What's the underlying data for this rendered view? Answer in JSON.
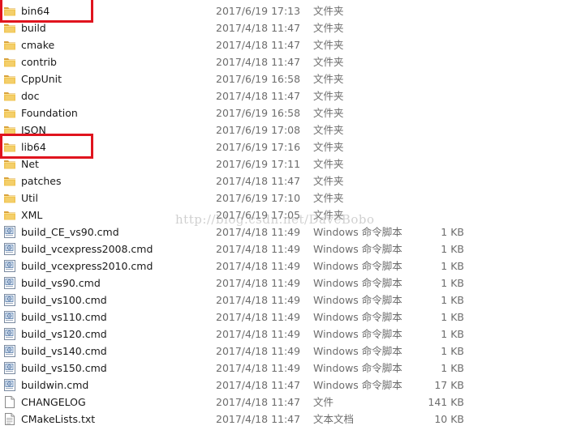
{
  "files": [
    {
      "name": "bin64",
      "date": "2017/6/19 17:13",
      "type": "文件夹",
      "size": "",
      "icon": "folder-icon"
    },
    {
      "name": "build",
      "date": "2017/4/18 11:47",
      "type": "文件夹",
      "size": "",
      "icon": "folder-icon"
    },
    {
      "name": "cmake",
      "date": "2017/4/18 11:47",
      "type": "文件夹",
      "size": "",
      "icon": "folder-icon"
    },
    {
      "name": "contrib",
      "date": "2017/4/18 11:47",
      "type": "文件夹",
      "size": "",
      "icon": "folder-icon"
    },
    {
      "name": "CppUnit",
      "date": "2017/6/19 16:58",
      "type": "文件夹",
      "size": "",
      "icon": "folder-icon"
    },
    {
      "name": "doc",
      "date": "2017/4/18 11:47",
      "type": "文件夹",
      "size": "",
      "icon": "folder-icon"
    },
    {
      "name": "Foundation",
      "date": "2017/6/19 16:58",
      "type": "文件夹",
      "size": "",
      "icon": "folder-icon"
    },
    {
      "name": "JSON",
      "date": "2017/6/19 17:08",
      "type": "文件夹",
      "size": "",
      "icon": "folder-icon"
    },
    {
      "name": "lib64",
      "date": "2017/6/19 17:16",
      "type": "文件夹",
      "size": "",
      "icon": "folder-icon"
    },
    {
      "name": "Net",
      "date": "2017/6/19 17:11",
      "type": "文件夹",
      "size": "",
      "icon": "folder-icon"
    },
    {
      "name": "patches",
      "date": "2017/4/18 11:47",
      "type": "文件夹",
      "size": "",
      "icon": "folder-icon"
    },
    {
      "name": "Util",
      "date": "2017/6/19 17:10",
      "type": "文件夹",
      "size": "",
      "icon": "folder-icon"
    },
    {
      "name": "XML",
      "date": "2017/6/19 17:05",
      "type": "文件夹",
      "size": "",
      "icon": "folder-icon"
    },
    {
      "name": "build_CE_vs90.cmd",
      "date": "2017/4/18 11:49",
      "type": "Windows 命令脚本",
      "size": "1 KB",
      "icon": "cmd-script-icon"
    },
    {
      "name": "build_vcexpress2008.cmd",
      "date": "2017/4/18 11:49",
      "type": "Windows 命令脚本",
      "size": "1 KB",
      "icon": "cmd-script-icon"
    },
    {
      "name": "build_vcexpress2010.cmd",
      "date": "2017/4/18 11:49",
      "type": "Windows 命令脚本",
      "size": "1 KB",
      "icon": "cmd-script-icon"
    },
    {
      "name": "build_vs90.cmd",
      "date": "2017/4/18 11:49",
      "type": "Windows 命令脚本",
      "size": "1 KB",
      "icon": "cmd-script-icon"
    },
    {
      "name": "build_vs100.cmd",
      "date": "2017/4/18 11:49",
      "type": "Windows 命令脚本",
      "size": "1 KB",
      "icon": "cmd-script-icon"
    },
    {
      "name": "build_vs110.cmd",
      "date": "2017/4/18 11:49",
      "type": "Windows 命令脚本",
      "size": "1 KB",
      "icon": "cmd-script-icon"
    },
    {
      "name": "build_vs120.cmd",
      "date": "2017/4/18 11:49",
      "type": "Windows 命令脚本",
      "size": "1 KB",
      "icon": "cmd-script-icon"
    },
    {
      "name": "build_vs140.cmd",
      "date": "2017/4/18 11:49",
      "type": "Windows 命令脚本",
      "size": "1 KB",
      "icon": "cmd-script-icon"
    },
    {
      "name": "build_vs150.cmd",
      "date": "2017/4/18 11:49",
      "type": "Windows 命令脚本",
      "size": "1 KB",
      "icon": "cmd-script-icon"
    },
    {
      "name": "buildwin.cmd",
      "date": "2017/4/18 11:47",
      "type": "Windows 命令脚本",
      "size": "17 KB",
      "icon": "cmd-script-icon"
    },
    {
      "name": "CHANGELOG",
      "date": "2017/4/18 11:47",
      "type": "文件",
      "size": "141 KB",
      "icon": "file-icon"
    },
    {
      "name": "CMakeLists.txt",
      "date": "2017/4/18 11:47",
      "type": "文本文档",
      "size": "10 KB",
      "icon": "text-file-icon"
    }
  ],
  "highlighted": [
    "bin64",
    "lib64"
  ],
  "watermark": "http://blog.csdn.net/DaveBobo",
  "colors": {
    "highlight_border": "#e0141e",
    "folder_body": "#e8b94a",
    "folder_tab": "#d9a23a",
    "meta_text": "#6d6d6d"
  }
}
